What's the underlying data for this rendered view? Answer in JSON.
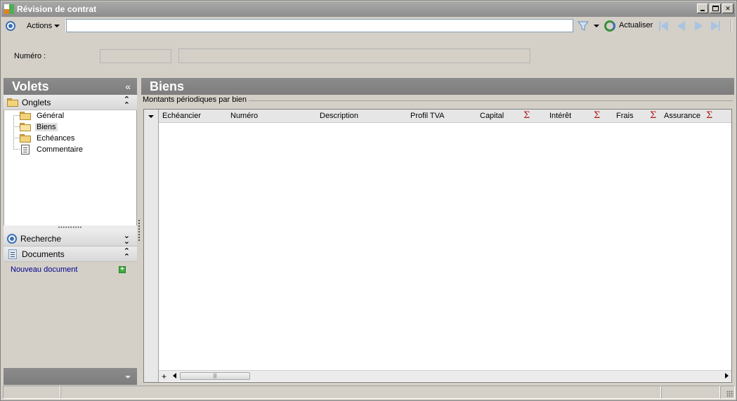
{
  "window": {
    "title": "Révision de contrat"
  },
  "toolbar": {
    "actions_label": "Actions",
    "search_value": "",
    "refresh_label": "Actualiser"
  },
  "form": {
    "numero_label": "Numéro :",
    "numero_value1": "",
    "numero_value2": ""
  },
  "left_pane": {
    "title": "Volets",
    "collapse_glyph": "«",
    "onglets_label": "Onglets",
    "tree_items": [
      {
        "label": "Général",
        "icon": "folder-icon"
      },
      {
        "label": "Biens",
        "icon": "folder-open-icon",
        "selected": true
      },
      {
        "label": "Echéances",
        "icon": "folder-icon"
      },
      {
        "label": "Commentaire",
        "icon": "document-icon"
      }
    ],
    "recherche_label": "Recherche",
    "documents_label": "Documents",
    "new_document_label": "Nouveau document"
  },
  "right_pane": {
    "title": "Biens",
    "section_label": "Montants périodiques par bien",
    "columns": [
      "Echéancier",
      "Numéro",
      "Description",
      "Profil TVA",
      "Capital",
      "Intérêt",
      "Frais",
      "Assurance"
    ],
    "sigma_glyph": "Σ"
  },
  "colors": {
    "header_gray": "#8b8b8b",
    "window_bg": "#d4d0c8",
    "link_blue": "#00008b",
    "sigma_red": "#b01818",
    "accent_blue": "#3a6fb5"
  }
}
